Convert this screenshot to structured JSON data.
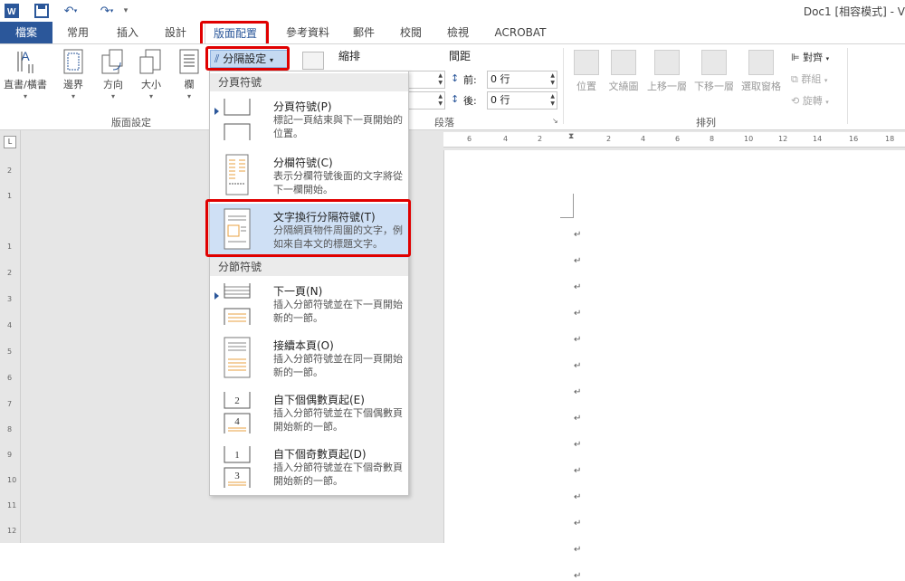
{
  "titlebar": {
    "app_icon": "word-icon",
    "doc_title": "Doc1 [相容模式] - V"
  },
  "tabs": [
    {
      "label": "檔案"
    },
    {
      "label": "常用"
    },
    {
      "label": "插入"
    },
    {
      "label": "設計"
    },
    {
      "label": "版面配置"
    },
    {
      "label": "參考資料"
    },
    {
      "label": "郵件"
    },
    {
      "label": "校閱"
    },
    {
      "label": "檢視"
    },
    {
      "label": "ACROBAT"
    }
  ],
  "ribbon": {
    "page_setup": {
      "group_label": "版面設定",
      "buttons": [
        {
          "label": "直書/橫書"
        },
        {
          "label": "邊界"
        },
        {
          "label": "方向"
        },
        {
          "label": "大小"
        },
        {
          "label": "欄"
        }
      ],
      "breaks_button": "分隔設定"
    },
    "paragraph": {
      "group_label": "段落",
      "indent_label": "縮排",
      "spacing_label": "間距",
      "before_label": "前:",
      "after_label": "後:",
      "before_value": "0 行",
      "after_value": "0 行"
    },
    "arrange": {
      "group_label": "排列",
      "buttons": [
        {
          "label": "位置"
        },
        {
          "label": "文繞圖"
        },
        {
          "label": "上移一層"
        },
        {
          "label": "下移一層"
        },
        {
          "label": "選取窗格"
        }
      ],
      "align_label": "對齊",
      "group_btn_label": "群組",
      "rotate_label": "旋轉"
    }
  },
  "ruler": {
    "ticks": [
      "6",
      "4",
      "2",
      "2",
      "4",
      "6",
      "8",
      "10",
      "12",
      "14",
      "16",
      "18"
    ]
  },
  "vruler": {
    "ticks": [
      "2",
      "1",
      "1",
      "2",
      "3",
      "4",
      "5",
      "6",
      "7",
      "8",
      "9",
      "10",
      "11",
      "12"
    ]
  },
  "breaks_menu": {
    "page_breaks_header": "分頁符號",
    "section_breaks_header": "分節符號",
    "page_items": [
      {
        "title": "分頁符號(P)",
        "desc": "標記一頁結束與下一頁開始的位置。"
      },
      {
        "title": "分欄符號(C)",
        "desc": "表示分欄符號後面的文字將從下一欄開始。"
      },
      {
        "title": "文字換行分隔符號(T)",
        "desc": "分隔網頁物件周圍的文字，例如來自本文的標題文字。"
      }
    ],
    "section_items": [
      {
        "title": "下一頁(N)",
        "desc": "插入分節符號並在下一頁開始新的一節。"
      },
      {
        "title": "接續本頁(O)",
        "desc": "插入分節符號並在同一頁開始新的一節。"
      },
      {
        "title": "自下個偶數頁起(E)",
        "desc": "插入分節符號並在下個偶數頁開始新的一節。",
        "icon_top_num": "2",
        "icon_bottom_num": "4"
      },
      {
        "title": "自下個奇數頁起(D)",
        "desc": "插入分節符號並在下個奇數頁開始新的一節。",
        "icon_top_num": "1",
        "icon_bottom_num": "3"
      }
    ]
  },
  "document": {
    "paragraph_mark": "↵"
  },
  "colors": {
    "accent": "#2b579a",
    "highlight_box": "#e00000",
    "menu_hover": "#cfe0f5",
    "icon_orange": "#e8a040"
  }
}
